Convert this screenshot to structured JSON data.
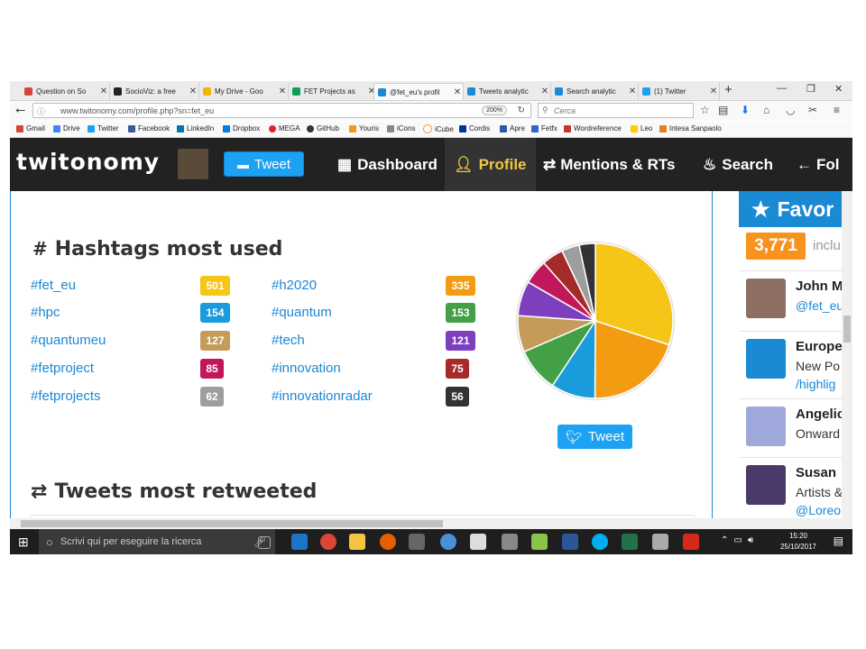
{
  "browser": {
    "tabs": [
      {
        "title": "Question on So",
        "color": "#d44638"
      },
      {
        "title": "SocioViz: a free",
        "color": "#222222"
      },
      {
        "title": "My Drive - Goo",
        "color": "#f4b400"
      },
      {
        "title": "FET Projects as",
        "color": "#0f9d58"
      },
      {
        "title": "@fet_eu's profil",
        "color": "#1a8ad4"
      },
      {
        "title": "Tweets analytic",
        "color": "#1a8ad4"
      },
      {
        "title": "Search analytic",
        "color": "#1a8ad4"
      },
      {
        "title": "(1) Twitter",
        "color": "#1da1f2"
      }
    ],
    "url": "www.twitonomy.com/profile.php?sn=fet_eu",
    "zoom": "200%",
    "search_placeholder": "Cerca",
    "bookmarks": [
      {
        "label": "Gmail",
        "color": "#d44638"
      },
      {
        "label": "Drive",
        "color": "#4285f4"
      },
      {
        "label": "Twitter",
        "color": "#1da1f2"
      },
      {
        "label": "Facebook",
        "color": "#3b5998"
      },
      {
        "label": "LinkedIn",
        "color": "#0077b5"
      },
      {
        "label": "Dropbox",
        "color": "#007ee5"
      },
      {
        "label": "MEGA",
        "color": "#d9272e"
      },
      {
        "label": "GitHub",
        "color": "#333333"
      },
      {
        "label": "Youris",
        "color": "#f7931e"
      },
      {
        "label": "iCons",
        "color": "#888888"
      },
      {
        "label": "iCube",
        "color": "#f7931e"
      },
      {
        "label": "Cordis",
        "color": "#003399"
      },
      {
        "label": "Apre",
        "color": "#2a5caa"
      },
      {
        "label": "Fetfx",
        "color": "#3366cc"
      },
      {
        "label": "Wordreference",
        "color": "#c0392b"
      },
      {
        "label": "Leo",
        "color": "#ffcc00"
      },
      {
        "label": "Intesa Sanpaolo",
        "color": "#e67e22"
      }
    ]
  },
  "site": {
    "logo": "twitonomy",
    "tweet_button": "Tweet",
    "nav": [
      "Dashboard",
      "Profile",
      "Mentions & RTs",
      "Search",
      "Fol"
    ]
  },
  "hashtags": {
    "title": "Hashtags most used",
    "items": [
      {
        "tag": "#fet_eu",
        "count": "501",
        "color": "#f5c518"
      },
      {
        "tag": "#hpc",
        "count": "154",
        "color": "#1a9bdb"
      },
      {
        "tag": "#quantumeu",
        "count": "127",
        "color": "#c59b5a"
      },
      {
        "tag": "#fetproject",
        "count": "85",
        "color": "#c2185b"
      },
      {
        "tag": "#fetprojects",
        "count": "62",
        "color": "#9e9e9e"
      },
      {
        "tag": "#h2020",
        "count": "335",
        "color": "#f39c12"
      },
      {
        "tag": "#quantum",
        "count": "153",
        "color": "#43a047"
      },
      {
        "tag": "#tech",
        "count": "121",
        "color": "#7e3fbf"
      },
      {
        "tag": "#innovation",
        "count": "75",
        "color": "#a52a2a"
      },
      {
        "tag": "#innovationradar",
        "count": "56",
        "color": "#333333"
      }
    ],
    "tweet_label": "Tweet"
  },
  "retweeted": {
    "title": "Tweets most retweeted"
  },
  "sidebar": {
    "title": "Favor",
    "count": "3,771",
    "count_suffix": "inclu",
    "people": [
      {
        "name": "John M",
        "line2": "@fet_eu",
        "line3": "",
        "color": "#8d6e63"
      },
      {
        "name": "Europe",
        "line2": "New Po",
        "line3": "/highlig",
        "color": "#1a8ad4"
      },
      {
        "name": "Angelic",
        "line2": "Onward",
        "line3": "",
        "color": "#9fa8da"
      },
      {
        "name": "Susan",
        "line2": "Artists &",
        "line3": "@Loreo",
        "color": "#4a3a6a"
      }
    ]
  },
  "taskbar": {
    "search_text": "Scrivi qui per eseguire la ricerca",
    "time": "15:20",
    "date": "25/10/2017"
  }
}
